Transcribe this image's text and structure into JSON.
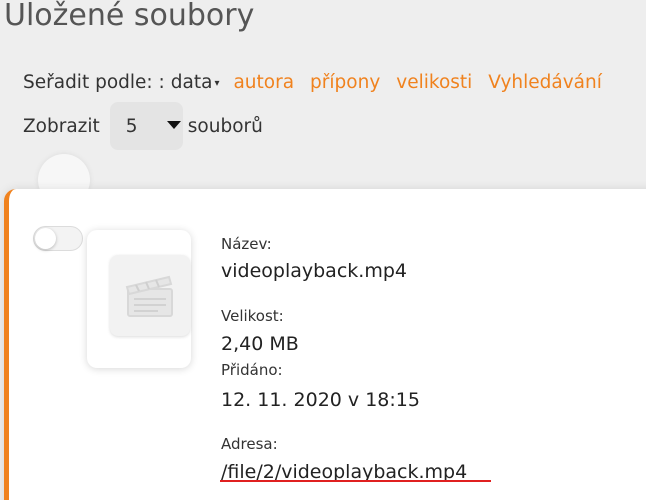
{
  "page": {
    "title": "Uložené soubory"
  },
  "sort": {
    "label": "Seřadit podle: :",
    "current": "data",
    "current_caret": "▾",
    "options": [
      "autora",
      "přípony",
      "velikosti",
      "Vyhledávání"
    ]
  },
  "show": {
    "label": "Zobrazit",
    "value": "5",
    "suffix": "souborů"
  },
  "file": {
    "icon": "video-clapperboard-icon",
    "name_label": "Název:",
    "name": "videoplayback.mp4",
    "size_label": "Velikost:",
    "size": "2,40 MB",
    "added_label": "Přidáno:",
    "added": "12. 11. 2020 v 18:15",
    "address_label": "Adresa:",
    "address": "/file/2/videoplayback.mp4"
  },
  "colors": {
    "accent": "#f0821e",
    "underline": "#e02020",
    "background": "#eeeeee",
    "card": "#ffffff"
  }
}
